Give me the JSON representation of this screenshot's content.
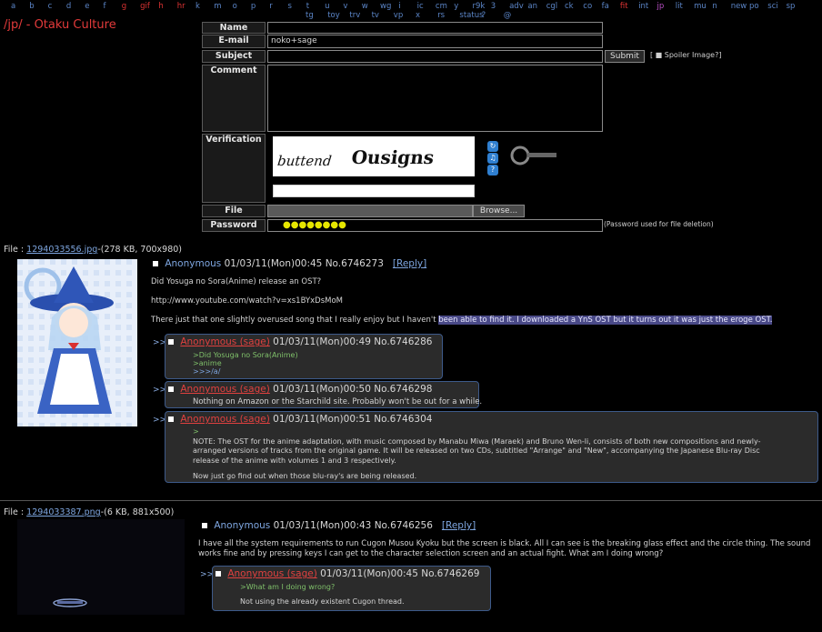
{
  "boards": [
    "a",
    "b",
    "c",
    "d",
    "e",
    "f",
    "g",
    "gif",
    "h",
    "hr",
    "k",
    "m",
    "o",
    "p",
    "r",
    "s",
    "t",
    "u",
    "v",
    "w",
    "wg",
    "i",
    "ic",
    "cm",
    "y",
    "r9k",
    "3",
    "adv",
    "an",
    "cgl",
    "ck",
    "co",
    "fa",
    "fit",
    "int",
    "jp",
    "lit",
    "mu",
    "n",
    "new",
    "po",
    "sci",
    "sp",
    "tg",
    "toy",
    "trv",
    "tv",
    "vp",
    "x",
    "rs",
    "status",
    "?",
    "@"
  ],
  "board_title": "/jp/ - Otaku Culture",
  "form": {
    "name_label": "Name",
    "email_label": "E-mail",
    "email_value": "noko+sage",
    "subject_label": "Subject",
    "submit_label": "Submit",
    "spoiler_label": "[ ■ Spoiler Image?]",
    "comment_label": "Comment",
    "verification_label": "Verification",
    "captcha_text": "buttend Ousigns",
    "file_label": "File",
    "browse_label": "Browse...",
    "password_label": "Password",
    "password_value": "●●●●●●●●",
    "password_note": "(Password used for file deletion)"
  },
  "threads": [
    {
      "file_label": "File :",
      "file_name": "1294033556.jpg",
      "file_meta": "-(278 KB, 700x980)",
      "op": {
        "name": "Anonymous",
        "date": "01/03/11(Mon)00:45",
        "number": "No.6746273",
        "reply_link": "[Reply]",
        "lines": [
          "Did Yosuga no Sora(Anime) release an OST?",
          "http://www.youtube.com/watch?v=xs1BYxDsMoM",
          "There just that one slightly overused song that I really enjoy but I haven't",
          "been able to find it. I downloaded a YnS OST but it turns out it was just the eroge OST."
        ]
      },
      "replies": [
        {
          "arrow": ">>",
          "name": "Anonymous (sage)",
          "date": "01/03/11(Mon)00:49",
          "number": "No.6746286",
          "lines": [
            ">Did Yosuga no Sora(Anime)",
            ">anime",
            ">>>/a/"
          ]
        },
        {
          "arrow": ">>",
          "name": "Anonymous (sage)",
          "date": "01/03/11(Mon)00:50",
          "number": "No.6746298",
          "lines": [
            "Nothing on Amazon or the Starchild site. Probably won't be out for a while."
          ]
        },
        {
          "arrow": ">>",
          "name": "Anonymous (sage)",
          "date": "01/03/11(Mon)00:51",
          "number": "No.6746304",
          "lines": [
            ">",
            "NOTE: The OST for the anime adaptation, with music composed by Manabu Miwa (Maraek) and Bruno Wen-li, consists of both new compositions and newly-",
            "arranged versions of tracks from the original game. It will be released on two CDs, subtitled \"Arrange\" and \"New\", accompanying the Japanese Blu-ray Disc",
            "release of the anime with volumes 1 and 3 respectively.",
            "",
            "Now just go find out when those blu-ray's are being released."
          ]
        }
      ]
    },
    {
      "file_label": "File :",
      "file_name": "1294033387.png",
      "file_meta": "-(6 KB, 881x500)",
      "op": {
        "name": "Anonymous",
        "date": "01/03/11(Mon)00:43",
        "number": "No.6746256",
        "reply_link": "[Reply]",
        "lines": [
          "I have all the system requirements to run Cugon Musou Kyoku but the screen is black. All I can see is the breaking glass effect and the circle thing. The sound",
          "works fine and by pressing keys I can get to the character selection screen and an actual fight. What am I doing wrong?"
        ]
      },
      "replies": [
        {
          "arrow": ">>",
          "name": "Anonymous (sage)",
          "date": "01/03/11(Mon)00:45",
          "number": "No.6746269",
          "lines": [
            ">What am I doing wrong?",
            "",
            "Not using the already existent Cugon thread."
          ]
        }
      ]
    }
  ]
}
